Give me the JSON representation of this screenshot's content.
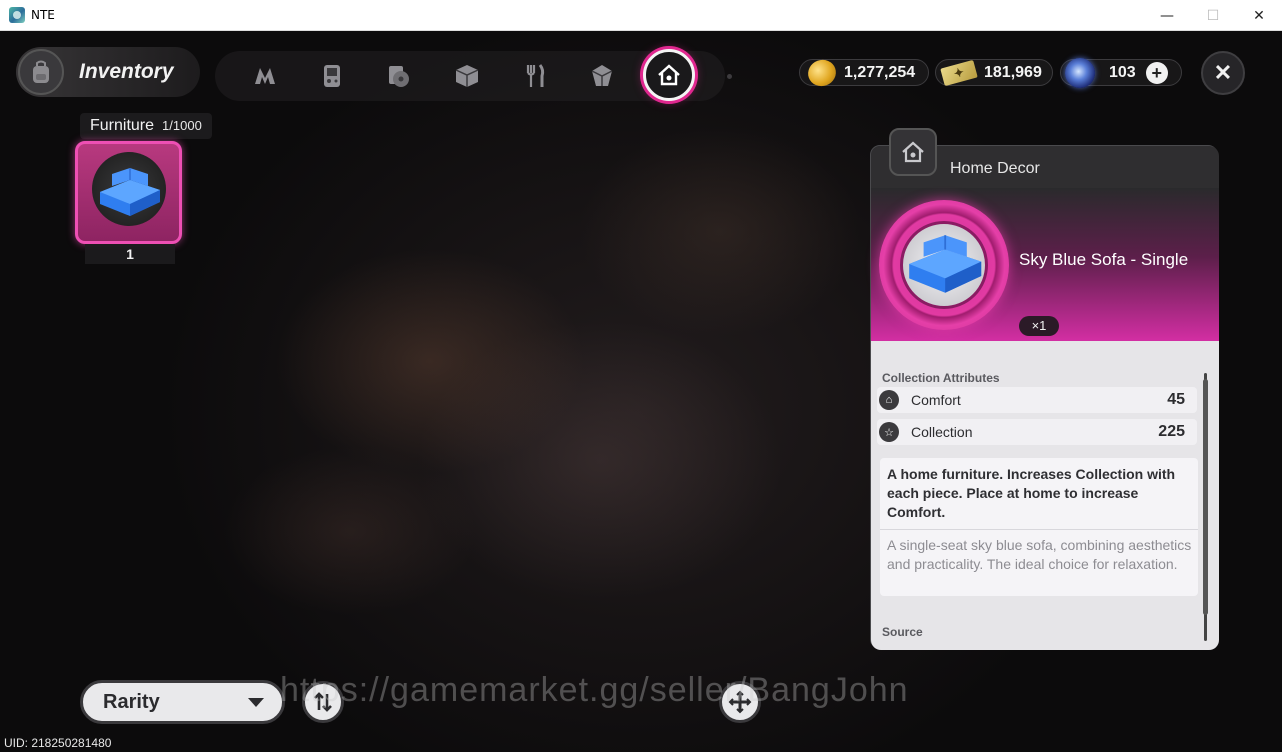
{
  "window": {
    "title": "NTE",
    "minimize": "—",
    "maximize": "☐",
    "close": "✕"
  },
  "header": {
    "title": "Inventory",
    "icon": "backpack-icon"
  },
  "tabs": [
    {
      "icon": "nte-logo-icon",
      "active": false
    },
    {
      "icon": "gameboy-icon",
      "active": false
    },
    {
      "icon": "disc-card-icon",
      "active": false
    },
    {
      "icon": "box-icon",
      "active": false
    },
    {
      "icon": "fork-knife-icon",
      "active": false
    },
    {
      "icon": "cube-gem-icon",
      "active": false
    },
    {
      "icon": "home-decor-icon",
      "active": true
    }
  ],
  "currencies": [
    {
      "icon": "gold-coin-icon",
      "value": "1,277,254"
    },
    {
      "icon": "ticket-icon",
      "value": "181,969"
    },
    {
      "icon": "blue-orb-icon",
      "value": "103",
      "add": "+"
    }
  ],
  "close_glyph": "✕",
  "section": {
    "name": "Furniture",
    "count": "1/1000"
  },
  "items": [
    {
      "name": "Sky Blue Sofa - Single",
      "qty": "1"
    }
  ],
  "detail": {
    "category": "Home Decor",
    "item_name": "Sky Blue Sofa - Single",
    "count": "×1",
    "attrs_title": "Collection Attributes",
    "attrs": [
      {
        "label": "Comfort",
        "value": "45",
        "icon": "home-small-icon"
      },
      {
        "label": "Collection",
        "value": "225",
        "icon": "star-small-icon"
      }
    ],
    "description": "A home furniture. Increases Collection with each piece. Place at home to increase Comfort.",
    "flavor": "A single-seat sky blue sofa, combining aesthetics and practicality. The ideal choice for relaxation.",
    "source_title": "Source"
  },
  "controls": {
    "sort_label": "Rarity"
  },
  "watermark": "https://gamemarket.gg/seller/BangJohn",
  "uid": "UID: 218250281480",
  "colors": {
    "accent_pink": "#e0278f",
    "rarity_bg": "#b8397f"
  }
}
